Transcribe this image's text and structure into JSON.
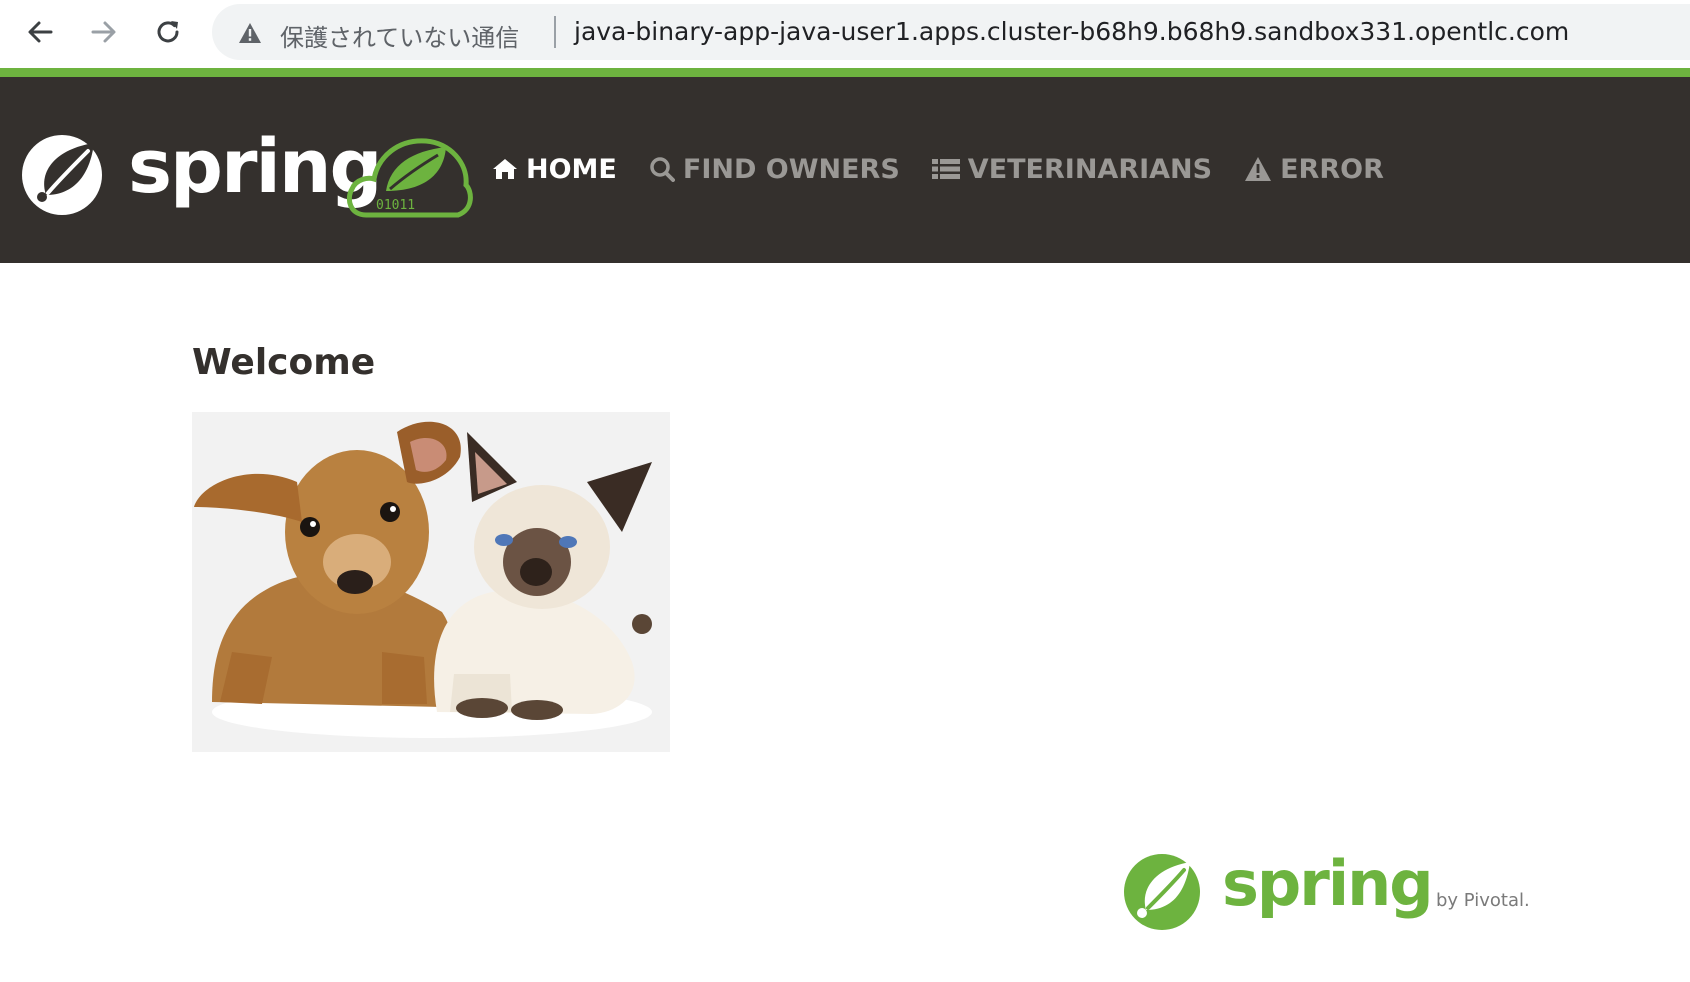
{
  "browser": {
    "security_label": "保護されていない通信",
    "url": "java-binary-app-java-user1.apps.cluster-b68h9.b68h9.sandbox331.opentlc.com",
    "back_icon": "arrow-left-icon",
    "forward_icon": "arrow-right-icon",
    "reload_icon": "reload-icon",
    "security_icon": "warning-triangle-icon"
  },
  "header": {
    "brand_text": "spring",
    "nav": [
      {
        "label": "HOME",
        "icon": "home-icon",
        "active": true
      },
      {
        "label": "FIND OWNERS",
        "icon": "search-icon",
        "active": false
      },
      {
        "label": "VETERINARIANS",
        "icon": "list-icon",
        "active": false
      },
      {
        "label": "ERROR",
        "icon": "warning-triangle-icon",
        "active": false
      }
    ]
  },
  "main": {
    "title": "Welcome",
    "image_subject": "pets-image"
  },
  "footer": {
    "brand_text": "spring",
    "by_text": "by Pivotal."
  },
  "colors": {
    "spring_green": "#6db33f",
    "header_bg": "#34302d",
    "nav_inactive": "#9a9895",
    "nav_active": "#ffffff"
  }
}
